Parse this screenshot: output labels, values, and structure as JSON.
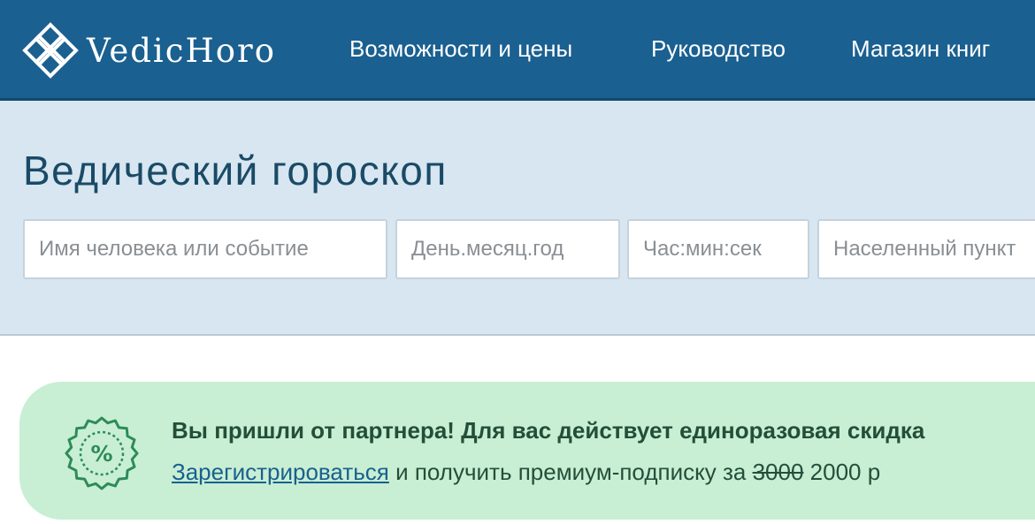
{
  "header": {
    "brand": "VedicHoro",
    "nav": [
      {
        "label": "Возможности и цены"
      },
      {
        "label": "Руководство"
      },
      {
        "label": "Магазин книг"
      }
    ]
  },
  "hero": {
    "title": "Ведический гороскоп",
    "fields": {
      "name_placeholder": "Имя человека или событие",
      "date_placeholder": "День.месяц.год",
      "time_placeholder": "Час:мин:сек",
      "place_placeholder": "Населенный пункт"
    }
  },
  "promo": {
    "icon": "percent-badge-icon",
    "headline": "Вы пришли от партнера! Для вас действует единоразовая скидка",
    "register_link": "Зарегистрироваться",
    "text_middle": " и получить премиум-подписку за ",
    "old_price": "3000",
    "new_price": " 2000 р"
  },
  "colors": {
    "nav_bg": "#1a6090",
    "hero_bg": "#d7e6f1",
    "title_color": "#1a4a66",
    "promo_bg": "#c8efd3",
    "promo_accent": "#2e8b57",
    "link_color": "#1a6090"
  }
}
